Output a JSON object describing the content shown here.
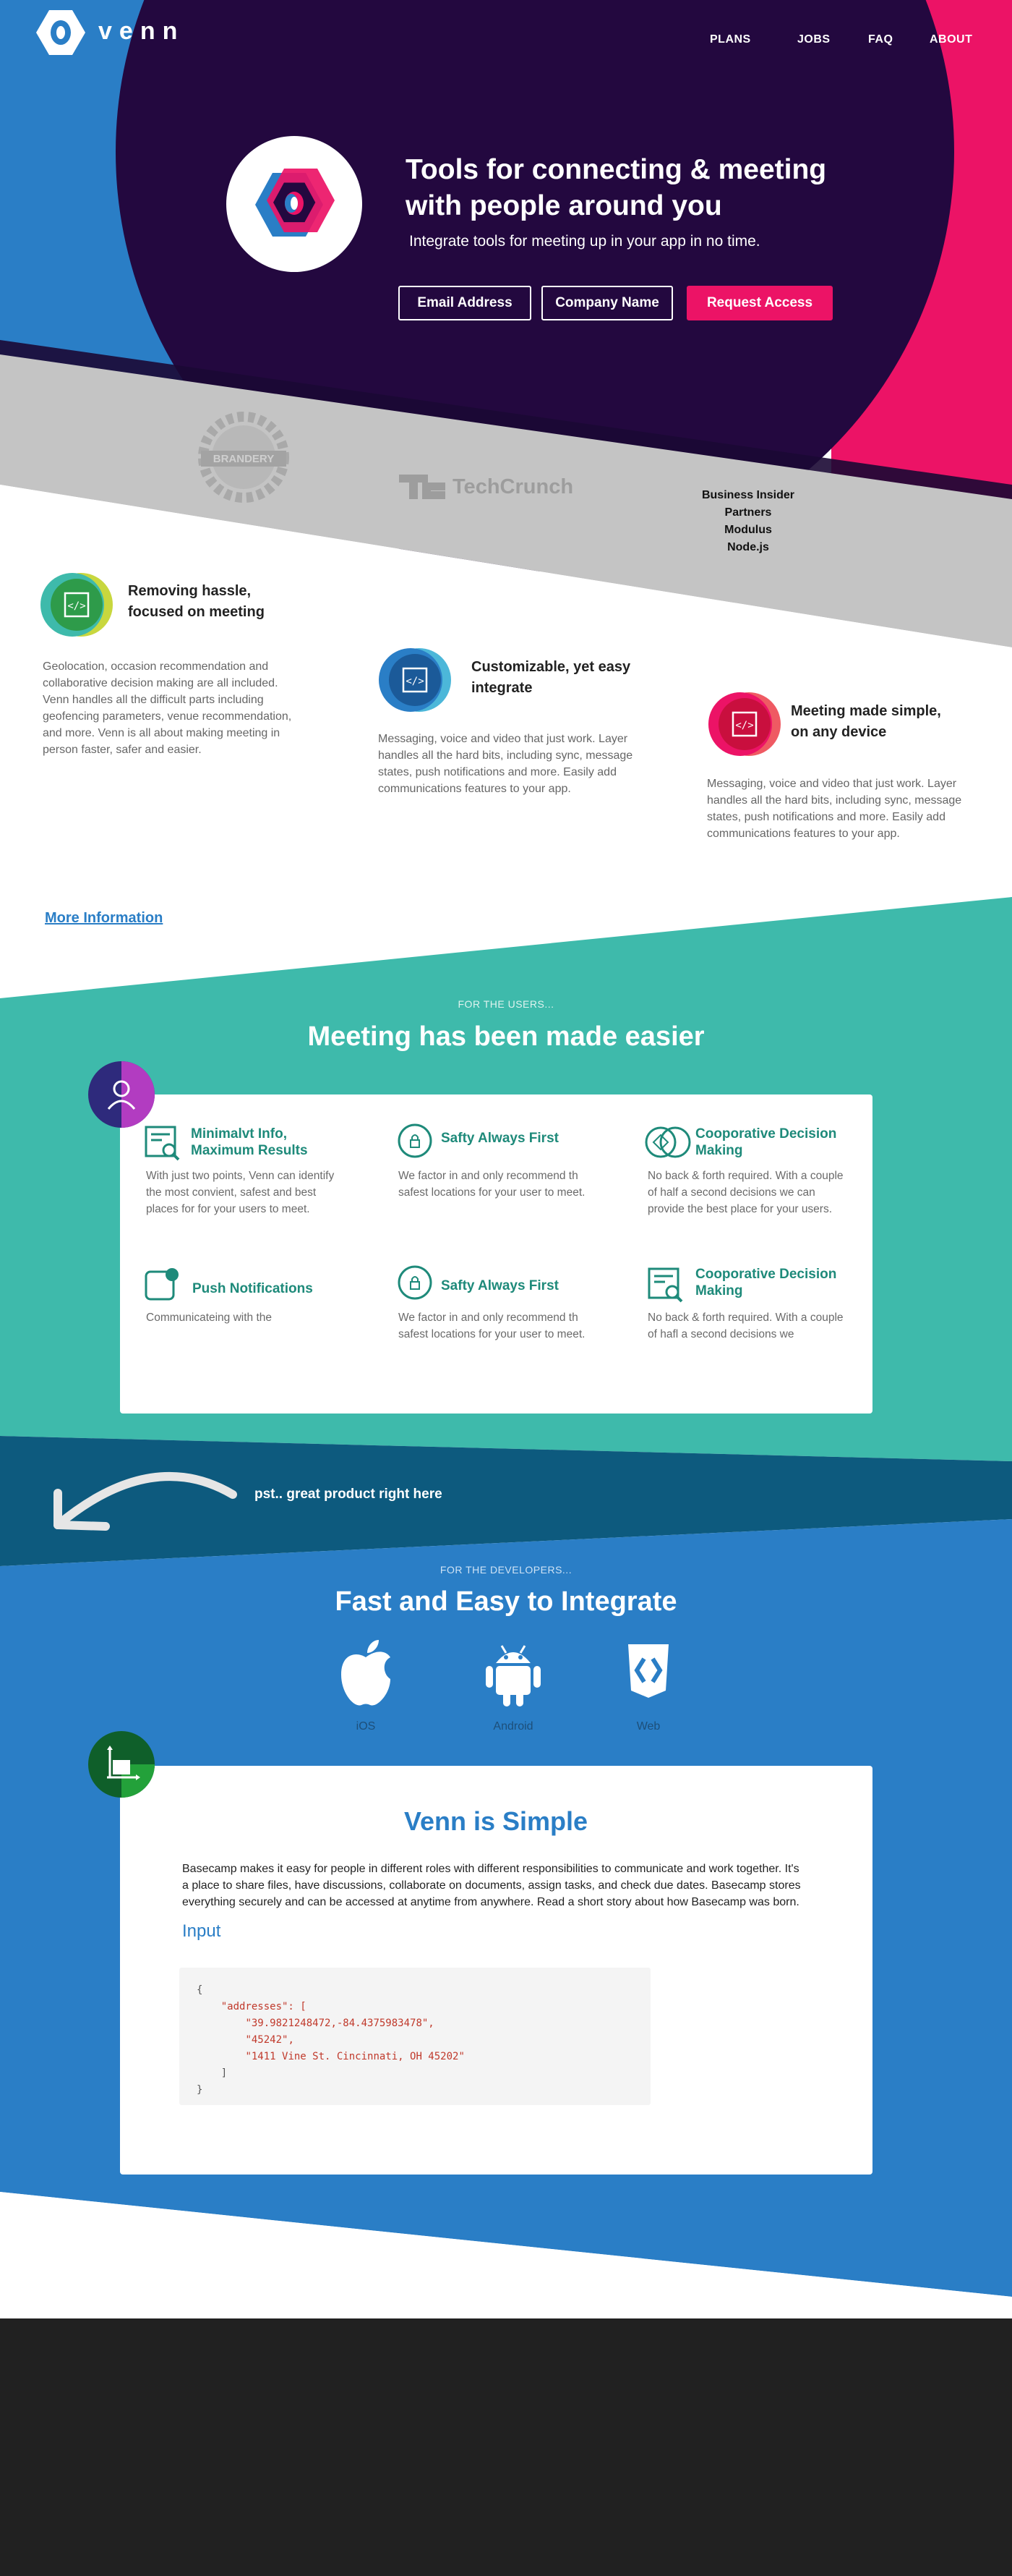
{
  "brand": {
    "name": "venn"
  },
  "nav": {
    "items": [
      "PLANS",
      "JOBS",
      "FAQ",
      "ABOUT"
    ]
  },
  "hero": {
    "title": "Tools for connecting & meeting with people around you",
    "subtitle": "Integrate tools for meeting up in your app in no time.",
    "email_placeholder": "Email Address",
    "company_placeholder": "Company Name",
    "cta": "Request Access"
  },
  "partners": {
    "brandery": "BRANDERY",
    "techcrunch": "TechCrunch",
    "list": [
      "Business Insider",
      "Partners",
      "Modulus",
      "Node.js"
    ]
  },
  "features": [
    {
      "title": "Removing hassle, focused on meeting",
      "text": "Geolocation, occasion recommendation and collaborative decision making are all included. Venn handles all the difficult parts including geofencing parameters, venue recommendation, and more. Venn is all about making meeting in person faster, safer and easier."
    },
    {
      "title": "Customizable, yet easy integrate",
      "text": "Messaging, voice and video that just work. Layer handles all the hard bits, including sync, message states, push notifications and more. Easily add communications features to your app."
    },
    {
      "title": "Meeting made simple, on any device",
      "text": "Messaging, voice and video that just work. Layer handles all the hard bits, including sync, message states, push notifications and more. Easily add communications features to your app."
    }
  ],
  "more_info": "More Information",
  "users": {
    "tag": "FOR THE USERS...",
    "title": "Meeting has been made easier",
    "items": [
      {
        "title": "Minimalvt Info, Maximum Results",
        "text": "With just two points, Venn can identify the most convient, safest and best places for for your users to meet."
      },
      {
        "title": "Safty Always First",
        "text": "We factor in and only recommend th safest locations for your user to meet."
      },
      {
        "title": "Cooporative Decision Making",
        "text": "No back & forth required. With a couple of half a second decisions we can provide the best place for your users."
      },
      {
        "title": "Push Notifications",
        "text": "Communicateing with the"
      },
      {
        "title": "Safty Always First",
        "text": "We factor in and only recommend th safest locations for your user to meet."
      },
      {
        "title": "Cooporative Decision Making",
        "text": "No back & forth required. With a couple of hafl a second decisions we"
      }
    ]
  },
  "tagline": "pst.. great product right here",
  "developers": {
    "tag": "FOR THE DEVELOPERS...",
    "title": "Fast and Easy to Integrate",
    "platforms": [
      "iOS",
      "Android",
      "Web"
    ]
  },
  "simple": {
    "title": "Venn is Simple",
    "text": "Basecamp makes it easy for people in different roles with different responsibilities to communicate and work together. It's a place to share files, have discussions, collaborate on documents, assign tasks, and check due dates. Basecamp stores everything securely and can be accessed at anytime from anywhere. Read a short story about how Basecamp was born.",
    "input_label": "Input",
    "code": {
      "open": "{",
      "key": "\"addresses\": [",
      "values": [
        "\"39.9821248472,-84.4375983478\",",
        "\"45242\",",
        "\"1411 Vine St. Cincinnati, OH 45202\""
      ],
      "close_arr": "]",
      "close": "}"
    }
  },
  "colors": {
    "blue": "#2a7ec6",
    "dark_purple": "#23083f",
    "pink": "#ec1366",
    "grey_band": "#c4c4c4",
    "teal": "#3ebaab",
    "dark_teal": "#0d5a7e",
    "footer": "#212121"
  }
}
